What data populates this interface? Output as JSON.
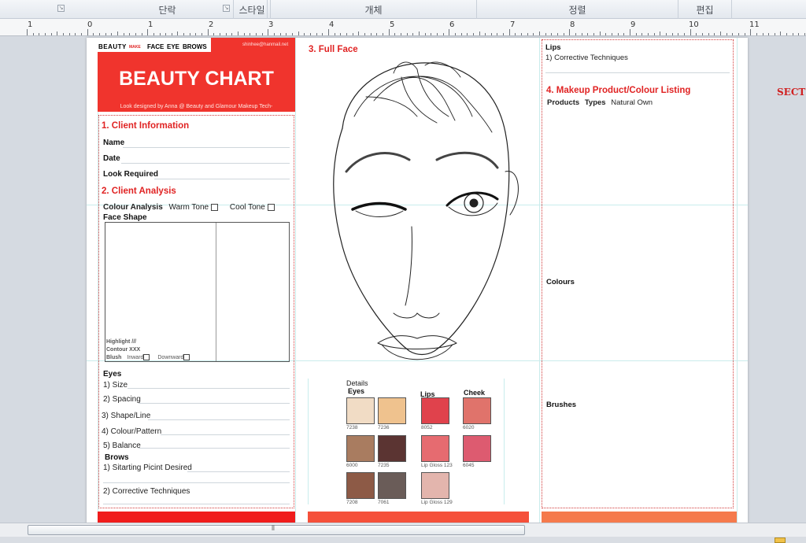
{
  "ribbon": {
    "groups": [
      "단락",
      "스타일",
      "개체",
      "정렬",
      "편집"
    ]
  },
  "ruler": {
    "labels": [
      "1",
      "0",
      "1",
      "2",
      "3",
      "4",
      "5",
      "6",
      "7",
      "8",
      "9",
      "10",
      "11"
    ]
  },
  "side_label": "SECT",
  "panel1": {
    "nav_brand": "BEAUTY",
    "nav_brand_sub": "MAKE",
    "nav_items": [
      "FACE",
      "EYE",
      "BROWS"
    ],
    "nav_email": "shinhee@hanmail.net",
    "banner_title": "BEAUTY CHART",
    "banner_subtitle": "Look designed by Anna @ Beauty and Glamour Makeup Tech-",
    "section1_title": "1. Client Information",
    "name_label": "Name",
    "date_label": "Date",
    "look_label": "Look Required",
    "section2_title": "2. Client Analysis",
    "colour_analysis_label": "Colour Analysis",
    "warm_tone_label": "Warm Tone",
    "cool_tone_label": "Cool Tone",
    "face_shape_label": "Face Shape",
    "highlight_label": "Highlight ///",
    "contour_label": "Contour XXX",
    "blush_label": "Blush",
    "inward_label": "Inward",
    "downward_label": "Downward",
    "eyes_label": "Eyes",
    "eye_items": [
      "1) Size",
      "2) Spacing",
      "3) Shape/Line",
      "4) Colour/Pattern",
      "5) Balance"
    ],
    "brows_label": "Brows",
    "brow_items": [
      "1) Sitarting Picint Desired",
      "2) Corrective Techniques"
    ]
  },
  "panel2": {
    "title": "3. Full Face",
    "details_label": "Details",
    "eyes_col": "Eyes",
    "lips_col": "Lips",
    "cheek_col": "Cheek",
    "swatches": [
      {
        "color": "#f1dcc5",
        "code": "7238"
      },
      {
        "color": "#efc28e",
        "code": "7236"
      },
      {
        "color": "#e0424c",
        "code": "8052"
      },
      {
        "color": "#e0736b",
        "code": "6020"
      },
      {
        "color": "#a97c60",
        "code": "6000"
      },
      {
        "color": "#5b3432",
        "code": "7235"
      },
      {
        "color": "#e66b70",
        "code": "Lip Gloss 123"
      },
      {
        "color": "#dd5b70",
        "code": "6045"
      },
      {
        "color": "#8d5a46",
        "code": "7208"
      },
      {
        "color": "#6a5c58",
        "code": "7061"
      },
      {
        "color": "#e3b5ad",
        "code": "Lip Gloss 129"
      }
    ]
  },
  "panel3": {
    "lips_label": "Lips",
    "lips_item": "1) Corrective Techniques",
    "section4_title": "4. Makeup Product/Colour Listing",
    "products_label": "Products",
    "types_label": "Types",
    "natural_own": "Natural Own",
    "colours_label": "Colours",
    "brushes_label": "Brushes"
  },
  "colors": {
    "banner": "#f0342d",
    "footer1": "#f01c1c",
    "footer2": "#f5503a",
    "footer3": "#f57a4c",
    "accent": "#e02323"
  }
}
